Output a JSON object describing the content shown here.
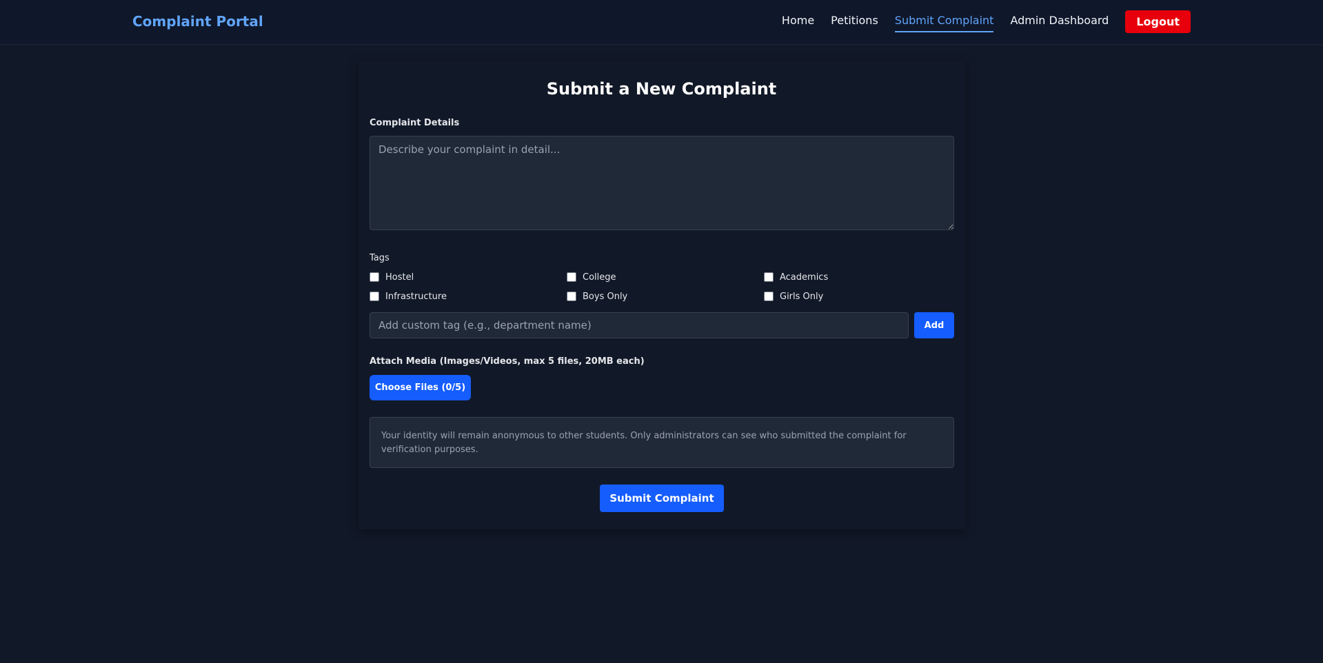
{
  "nav": {
    "brand": "Complaint Portal",
    "links": [
      {
        "label": "Home",
        "active": false
      },
      {
        "label": "Petitions",
        "active": false
      },
      {
        "label": "Submit Complaint",
        "active": true
      },
      {
        "label": "Admin Dashboard",
        "active": false
      }
    ],
    "logout_label": "Logout"
  },
  "form": {
    "title": "Submit a New Complaint",
    "details_label": "Complaint Details",
    "details_placeholder": "Describe your complaint in detail...",
    "tags_label": "Tags",
    "tags": [
      {
        "label": "Hostel",
        "checked": false
      },
      {
        "label": "College",
        "checked": false
      },
      {
        "label": "Academics",
        "checked": false
      },
      {
        "label": "Infrastructure",
        "checked": false
      },
      {
        "label": "Boys Only",
        "checked": false
      },
      {
        "label": "Girls Only",
        "checked": false
      }
    ],
    "custom_tag_placeholder": "Add custom tag (e.g., department name)",
    "add_label": "Add",
    "media_label": "Attach Media (Images/Videos, max 5 files, 20MB each)",
    "choose_files_label": "Choose Files (0/5)",
    "anonymity_notice": "Your identity will remain anonymous to other students. Only administrators can see who submitted the complaint for verification purposes.",
    "submit_label": "Submit Complaint"
  },
  "colors": {
    "background": "#111827",
    "navbar": "#0f172a",
    "brand": "#60a5fa",
    "primary": "#155dfc",
    "danger": "#e7000b",
    "input_bg": "#1f2937"
  }
}
